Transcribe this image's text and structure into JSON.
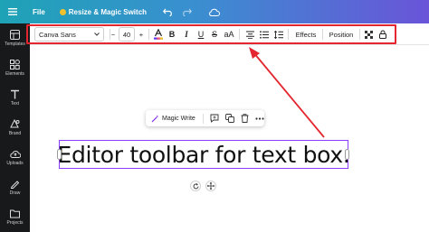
{
  "topbar": {
    "file_label": "File",
    "resize_label": "Resize & Magic Switch"
  },
  "sidebar": {
    "items": [
      {
        "label": "Templates",
        "icon": "templates-icon"
      },
      {
        "label": "Elements",
        "icon": "elements-icon"
      },
      {
        "label": "Text",
        "icon": "text-icon"
      },
      {
        "label": "Brand",
        "icon": "brand-icon"
      },
      {
        "label": "Uploads",
        "icon": "uploads-icon"
      },
      {
        "label": "Draw",
        "icon": "draw-icon"
      },
      {
        "label": "Projects",
        "icon": "projects-icon"
      }
    ]
  },
  "toolbar": {
    "font_name": "Canva Sans",
    "font_size": "40",
    "minus_label": "−",
    "plus_label": "+",
    "bold_label": "B",
    "italic_label": "I",
    "underline_label": "U",
    "strike_label": "S",
    "case_label": "aA",
    "effects_label": "Effects",
    "position_label": "Position"
  },
  "float_menu": {
    "magic_write_label": "Magic Write"
  },
  "canvas": {
    "text": "Editor toolbar for text box."
  },
  "colors": {
    "highlight": "#e3262f",
    "selection": "#8b3dff",
    "sidebar_bg": "#18191b"
  }
}
